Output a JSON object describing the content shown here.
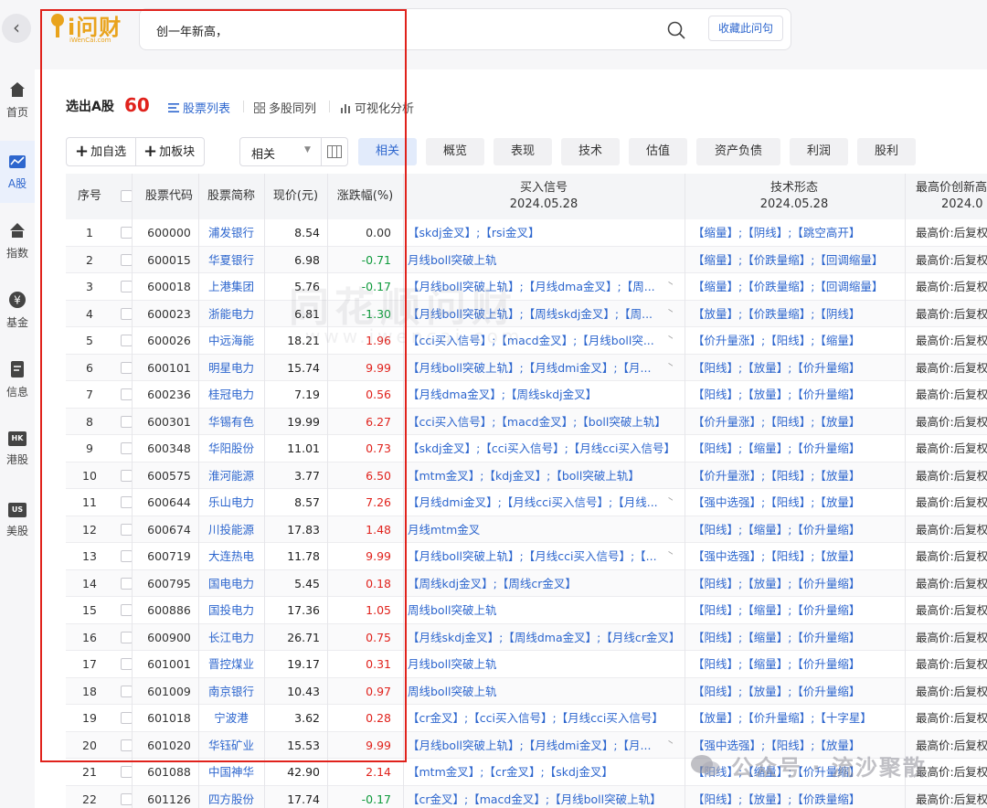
{
  "top": {
    "logo_text": "i问财",
    "logo_sub": "iWenCai.com",
    "search_query": "创一年新高，",
    "collect_label": "收藏此问句"
  },
  "sidebar": {
    "items": [
      {
        "label": "首页",
        "icon": "home-icon"
      },
      {
        "label": "A股",
        "icon": "chart-line-icon"
      },
      {
        "label": "指数",
        "icon": "index-icon"
      },
      {
        "label": "基金",
        "icon": "yen-coin-icon"
      },
      {
        "label": "信息",
        "icon": "document-icon"
      },
      {
        "label": "港股",
        "icon": "hk-badge-icon",
        "badge": "HK"
      },
      {
        "label": "美股",
        "icon": "us-badge-icon",
        "badge": "US"
      }
    ]
  },
  "result": {
    "title": "选出A股",
    "count": "60",
    "tabs": [
      "股票列表",
      "多股同列",
      "可视化分析"
    ]
  },
  "toolbar": {
    "add_watch": "加自选",
    "add_block": "加板块",
    "sort_value": "相关",
    "categories": [
      "相关",
      "概览",
      "表现",
      "技术",
      "估值",
      "资产负债",
      "利润",
      "股利"
    ]
  },
  "table": {
    "headers": {
      "idx": "序号",
      "code": "股票代码",
      "name": "股票简称",
      "price": "现价(元)",
      "change": "涨跌幅(%)",
      "signal": "买入信号",
      "signal_date": "2024.05.28",
      "tech": "技术形态",
      "tech_date": "2024.05.28",
      "high": "最高价创新高",
      "high_date": "2024.0"
    },
    "rows": [
      {
        "idx": "1",
        "code": "600000",
        "name": "浦发银行",
        "price": "8.54",
        "change": "0.00",
        "dir": "flat",
        "signal": "【skdj金叉】;【rsi金叉】",
        "expand": false,
        "tech": "【缩量】;【阴线】;【跳空高开】",
        "high": "最高价:后复权"
      },
      {
        "idx": "2",
        "code": "600015",
        "name": "华夏银行",
        "price": "6.98",
        "change": "-0.71",
        "dir": "down",
        "signal": "月线boll突破上轨",
        "expand": false,
        "tech": "【缩量】;【价跌量缩】;【回调缩量】",
        "high": "最高价:后复权"
      },
      {
        "idx": "3",
        "code": "600018",
        "name": "上港集团",
        "price": "5.76",
        "change": "-0.17",
        "dir": "down",
        "signal": "【月线boll突破上轨】;【月线dma金叉】;【周...",
        "expand": true,
        "tech": "【缩量】;【价跌量缩】;【回调缩量】",
        "high": "最高价:后复权"
      },
      {
        "idx": "4",
        "code": "600023",
        "name": "浙能电力",
        "price": "6.81",
        "change": "-1.30",
        "dir": "down",
        "signal": "【月线boll突破上轨】;【周线skdj金叉】;【周...",
        "expand": true,
        "tech": "【放量】;【价跌量缩】;【阴线】",
        "high": "最高价:后复权"
      },
      {
        "idx": "5",
        "code": "600026",
        "name": "中远海能",
        "price": "18.21",
        "change": "1.96",
        "dir": "up",
        "signal": "【cci买入信号】;【macd金叉】;【月线boll突...",
        "expand": true,
        "tech": "【价升量涨】;【阳线】;【缩量】",
        "high": "最高价:后复权"
      },
      {
        "idx": "6",
        "code": "600101",
        "name": "明星电力",
        "price": "15.74",
        "change": "9.99",
        "dir": "up",
        "signal": "【月线boll突破上轨】;【月线dmi金叉】;【月...",
        "expand": true,
        "tech": "【阳线】;【放量】;【价升量缩】",
        "high": "最高价:后复权"
      },
      {
        "idx": "7",
        "code": "600236",
        "name": "桂冠电力",
        "price": "7.19",
        "change": "0.56",
        "dir": "up",
        "signal": "【月线dma金叉】;【周线skdj金叉】",
        "expand": false,
        "tech": "【阳线】;【放量】;【价升量缩】",
        "high": "最高价:后复权"
      },
      {
        "idx": "8",
        "code": "600301",
        "name": "华锡有色",
        "price": "19.99",
        "change": "6.27",
        "dir": "up",
        "signal": "【cci买入信号】;【macd金叉】;【boll突破上轨】",
        "expand": false,
        "tech": "【价升量涨】;【阳线】;【放量】",
        "high": "最高价:后复权"
      },
      {
        "idx": "9",
        "code": "600348",
        "name": "华阳股份",
        "price": "11.01",
        "change": "0.73",
        "dir": "up",
        "signal": "【skdj金叉】;【cci买入信号】;【月线cci买入信号】",
        "expand": false,
        "tech": "【阳线】;【缩量】;【价升量缩】",
        "high": "最高价:后复权"
      },
      {
        "idx": "10",
        "code": "600575",
        "name": "淮河能源",
        "price": "3.77",
        "change": "6.50",
        "dir": "up",
        "signal": "【mtm金叉】;【kdj金叉】;【boll突破上轨】",
        "expand": false,
        "tech": "【价升量涨】;【阳线】;【放量】",
        "high": "最高价:后复权"
      },
      {
        "idx": "11",
        "code": "600644",
        "name": "乐山电力",
        "price": "8.57",
        "change": "7.26",
        "dir": "up",
        "signal": "【月线dmi金叉】;【月线cci买入信号】;【月线...",
        "expand": true,
        "tech": "【强中选强】;【阳线】;【放量】",
        "high": "最高价:后复权"
      },
      {
        "idx": "12",
        "code": "600674",
        "name": "川投能源",
        "price": "17.83",
        "change": "1.48",
        "dir": "up",
        "signal": "月线mtm金叉",
        "expand": false,
        "tech": "【阳线】;【缩量】;【价升量缩】",
        "high": "最高价:后复权"
      },
      {
        "idx": "13",
        "code": "600719",
        "name": "大连热电",
        "price": "11.78",
        "change": "9.99",
        "dir": "up",
        "signal": "【月线boll突破上轨】;【月线cci买入信号】;【...",
        "expand": true,
        "tech": "【强中选强】;【阳线】;【放量】",
        "high": "最高价:后复权"
      },
      {
        "idx": "14",
        "code": "600795",
        "name": "国电电力",
        "price": "5.45",
        "change": "0.18",
        "dir": "up",
        "signal": "【周线kdj金叉】;【周线cr金叉】",
        "expand": false,
        "tech": "【阳线】;【放量】;【价升量缩】",
        "high": "最高价:后复权"
      },
      {
        "idx": "15",
        "code": "600886",
        "name": "国投电力",
        "price": "17.36",
        "change": "1.05",
        "dir": "up",
        "signal": "周线boll突破上轨",
        "expand": false,
        "tech": "【阳线】;【缩量】;【价升量缩】",
        "high": "最高价:后复权"
      },
      {
        "idx": "16",
        "code": "600900",
        "name": "长江电力",
        "price": "26.71",
        "change": "0.75",
        "dir": "up",
        "signal": "【月线skdj金叉】;【周线dma金叉】;【月线cr金叉】",
        "expand": false,
        "tech": "【阳线】;【缩量】;【价升量缩】",
        "high": "最高价:后复权"
      },
      {
        "idx": "17",
        "code": "601001",
        "name": "晋控煤业",
        "price": "19.17",
        "change": "0.31",
        "dir": "up",
        "signal": "月线boll突破上轨",
        "expand": false,
        "tech": "【阳线】;【缩量】;【价升量缩】",
        "high": "最高价:后复权"
      },
      {
        "idx": "18",
        "code": "601009",
        "name": "南京银行",
        "price": "10.43",
        "change": "0.97",
        "dir": "up",
        "signal": "周线boll突破上轨",
        "expand": false,
        "tech": "【阳线】;【放量】;【价升量缩】",
        "high": "最高价:后复权"
      },
      {
        "idx": "19",
        "code": "601018",
        "name": "宁波港",
        "price": "3.62",
        "change": "0.28",
        "dir": "up",
        "signal": "【cr金叉】;【cci买入信号】;【月线cci买入信号】",
        "expand": false,
        "tech": "【放量】;【价升量缩】;【十字星】",
        "high": "最高价:后复权"
      },
      {
        "idx": "20",
        "code": "601020",
        "name": "华钰矿业",
        "price": "15.53",
        "change": "9.99",
        "dir": "up",
        "signal": "【月线boll突破上轨】;【月线dmi金叉】;【月...",
        "expand": true,
        "tech": "【强中选强】;【阳线】;【放量】",
        "high": "最高价:后复权"
      },
      {
        "idx": "21",
        "code": "601088",
        "name": "中国神华",
        "price": "42.90",
        "change": "2.14",
        "dir": "up",
        "signal": "【mtm金叉】;【cr金叉】;【skdj金叉】",
        "expand": false,
        "tech": "【阳线】;【缩量】;【价升量缩】",
        "high": "最高价:后复权"
      },
      {
        "idx": "22",
        "code": "601126",
        "name": "四方股份",
        "price": "17.74",
        "change": "-0.17",
        "dir": "down",
        "signal": "【cr金叉】;【macd金叉】;【月线boll突破上轨】",
        "expand": false,
        "tech": "【阳线】;【放量】;【价跌量缩】",
        "high": "最高价:后复权"
      }
    ]
  },
  "watermarks": {
    "center": "同花顺问财",
    "url": "www.iwencai.com",
    "wechat": "公众号 · 流沙聚散"
  },
  "colors": {
    "accent_blue": "#2d66ce",
    "up_red": "#e0221c",
    "down_green": "#0e9a3b",
    "highlight_red": "#e0221c",
    "logo_orange": "#e9a31c"
  }
}
